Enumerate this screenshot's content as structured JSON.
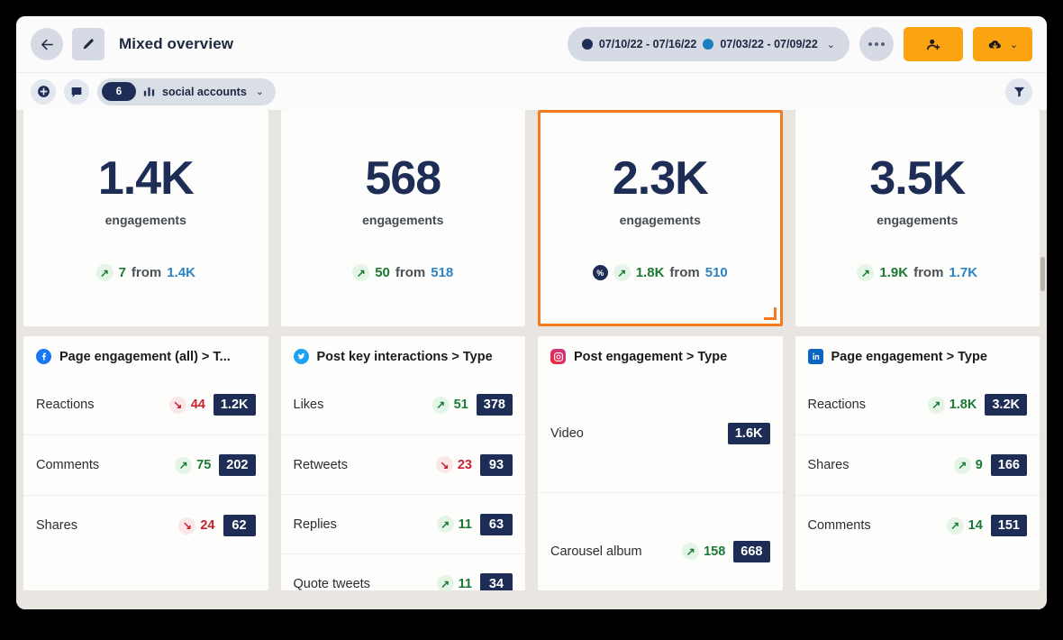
{
  "header": {
    "back_icon": "arrow-left-icon",
    "edit_icon": "pencil-icon",
    "title": "Mixed overview",
    "date_primary": "07/10/22 - 07/16/22",
    "date_compare": "07/03/22 - 07/09/22",
    "date_chevron": "⌄",
    "more_icon": "ellipsis-icon",
    "share_icon": "add-user-icon",
    "export_icon": "cloud-download-icon",
    "export_chevron": "⌄",
    "colors": {
      "accent_orange": "#fca311",
      "navy": "#1d2d56",
      "primary_dot": "#1d2d56",
      "compare_dot": "#1b7fbd"
    }
  },
  "toolbar": {
    "add_icon": "plus-circle-icon",
    "comment_icon": "comment-bubble-icon",
    "accounts_count": "6",
    "accounts_chart_icon": "bar-chart-icon",
    "accounts_label": "social accounts",
    "accounts_chevron": "⌄",
    "filter_icon": "funnel-icon"
  },
  "metric_cards": [
    {
      "value": "1.4K",
      "label": "engagements",
      "has_pct_badge": false,
      "pct_badge": "%",
      "trend": "up",
      "trend_arrow": "↗",
      "change": "7",
      "from_word": "from",
      "previous": "1.4K",
      "selected": false
    },
    {
      "value": "568",
      "label": "engagements",
      "has_pct_badge": false,
      "pct_badge": "%",
      "trend": "up",
      "trend_arrow": "↗",
      "change": "50",
      "from_word": "from",
      "previous": "518",
      "selected": false
    },
    {
      "value": "2.3K",
      "label": "engagements",
      "has_pct_badge": true,
      "pct_badge": "%",
      "trend": "up",
      "trend_arrow": "↗",
      "change": "1.8K",
      "from_word": "from",
      "previous": "510",
      "selected": true
    },
    {
      "value": "3.5K",
      "label": "engagements",
      "has_pct_badge": false,
      "pct_badge": "%",
      "trend": "up",
      "trend_arrow": "↗",
      "change": "1.9K",
      "from_word": "from",
      "previous": "1.7K",
      "selected": false
    }
  ],
  "panels": [
    {
      "network": "facebook",
      "network_icon": "facebook-icon",
      "title": "Page engagement (all) > T...",
      "rows": [
        {
          "label": "Reactions",
          "trend": "down",
          "arrow": "↘",
          "change": "44",
          "value": "1.2K"
        },
        {
          "label": "Comments",
          "trend": "up",
          "arrow": "↗",
          "change": "75",
          "value": "202"
        },
        {
          "label": "Shares",
          "trend": "down",
          "arrow": "↘",
          "change": "24",
          "value": "62"
        }
      ]
    },
    {
      "network": "twitter",
      "network_icon": "twitter-icon",
      "title": "Post key interactions > Type",
      "rows": [
        {
          "label": "Likes",
          "trend": "up",
          "arrow": "↗",
          "change": "51",
          "value": "378"
        },
        {
          "label": "Retweets",
          "trend": "down",
          "arrow": "↘",
          "change": "23",
          "value": "93"
        },
        {
          "label": "Replies",
          "trend": "up",
          "arrow": "↗",
          "change": "11",
          "value": "63"
        },
        {
          "label": "Quote tweets",
          "trend": "up",
          "arrow": "↗",
          "change": "11",
          "value": "34"
        }
      ]
    },
    {
      "network": "instagram",
      "network_icon": "instagram-icon",
      "title": "Post engagement > Type",
      "rows": [
        {
          "label": "Video",
          "trend": "none",
          "arrow": "",
          "change": "",
          "value": "1.6K"
        },
        {
          "label": "Carousel album",
          "trend": "up",
          "arrow": "↗",
          "change": "158",
          "value": "668"
        }
      ]
    },
    {
      "network": "linkedin",
      "network_icon": "linkedin-icon",
      "title": "Page engagement > Type",
      "rows": [
        {
          "label": "Reactions",
          "trend": "up",
          "arrow": "↗",
          "change": "1.8K",
          "value": "3.2K"
        },
        {
          "label": "Shares",
          "trend": "up",
          "arrow": "↗",
          "change": "9",
          "value": "166"
        },
        {
          "label": "Comments",
          "trend": "up",
          "arrow": "↗",
          "change": "14",
          "value": "151"
        }
      ]
    }
  ]
}
